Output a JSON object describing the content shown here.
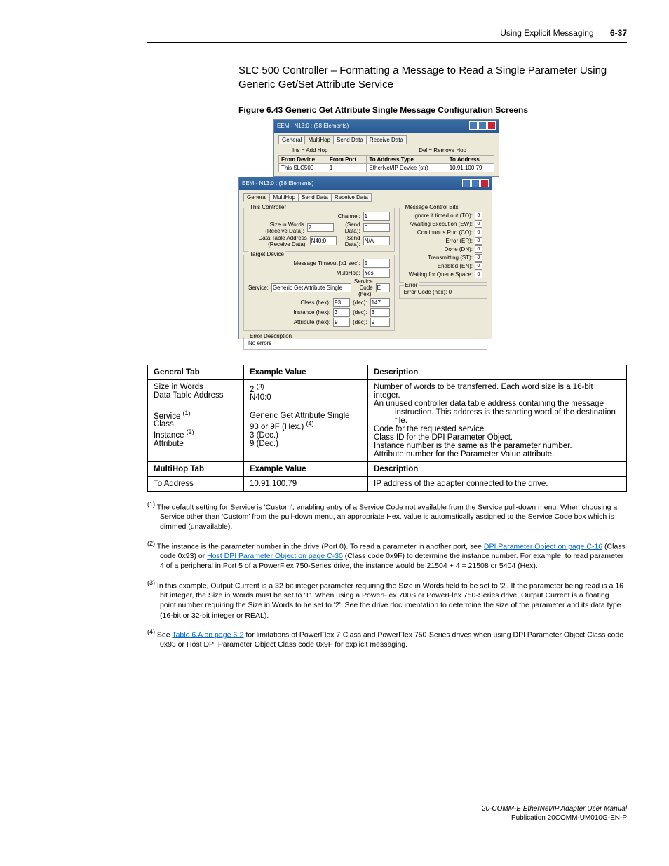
{
  "header": {
    "title": "Using Explicit Messaging",
    "pageno": "6-37"
  },
  "section_title": "SLC 500 Controller – Formatting a Message to Read a Single Parameter Using Generic Get/Set Attribute Service",
  "figure_caption": "Figure 6.43   Generic Get Attribute Single Message Configuration Screens",
  "win_top": {
    "title": "EEM - N13:0 : (58 Elements)",
    "tabs": [
      "General",
      "MultiHop",
      "Send Data",
      "Receive Data"
    ],
    "active_tab": 1,
    "hint_ins": "Ins = Add Hop",
    "hint_del": "Del = Remove Hop",
    "cols": [
      "From Device",
      "From Port",
      "To Address Type",
      "To Address"
    ],
    "row": [
      "This SLC500",
      "1",
      "EtherNet/IP Device (str)",
      "10.91.100.79"
    ]
  },
  "win_main": {
    "title": "EEM - N13:0 : (58 Elements)",
    "tabs": [
      "General",
      "MultiHop",
      "Send Data",
      "Receive Data"
    ],
    "active_tab": 0,
    "this_controller": {
      "legend": "This Controller",
      "channel_lbl": "Channel:",
      "channel": "1",
      "size_lbl": "Size in Words (Receive Data):",
      "size": "2",
      "senddata_lbl": "(Send Data):",
      "senddata": "0",
      "dta_lbl": "Data Table Address (Receive Data):",
      "dta": "N40:0",
      "senddata2_lbl": "(Send Data):",
      "senddata2": "N/A"
    },
    "target_device": {
      "legend": "Target Device",
      "timeout_lbl": "Message Timeout [x1 sec]:",
      "timeout": "5",
      "multihop_lbl": "MultiHop:",
      "multihop": "Yes",
      "service_lbl": "Service:",
      "service": "Generic Get Attribute Single",
      "svccode_lbl": "Service Code (hex):",
      "svccode": "E",
      "class_lbl": "Class (hex):",
      "class_hex": "93",
      "class_dec_lbl": "(dec):",
      "class_dec": "147",
      "inst_lbl": "Instance (hex):",
      "inst_hex": "3",
      "inst_dec_lbl": "(dec):",
      "inst_dec": "3",
      "attr_lbl": "Attribute (hex):",
      "attr_hex": "9",
      "attr_dec_lbl": "(dec):",
      "attr_dec": "9"
    },
    "mcb": {
      "legend": "Message Control Bits",
      "bits": [
        {
          "lbl": "Ignore if timed out (TO):",
          "v": "0"
        },
        {
          "lbl": "Awaiting Execution (EW):",
          "v": "0"
        },
        {
          "lbl": "Continuous Run (CO):",
          "v": "0"
        },
        {
          "lbl": "Error (ER):",
          "v": "0"
        },
        {
          "lbl": "Done (DN):",
          "v": "0"
        },
        {
          "lbl": "Transmitting (ST):",
          "v": "0"
        },
        {
          "lbl": "Enabled (EN):",
          "v": "0"
        },
        {
          "lbl": "Waiting for Queue Space:",
          "v": "0"
        }
      ]
    },
    "error_grp": {
      "legend": "Error",
      "code_lbl": "Error Code (hex): 0"
    },
    "errdesc_grp": {
      "legend": "Error Description",
      "text": "No errors"
    }
  },
  "table": {
    "headers1": [
      "General Tab",
      "Example Value",
      "Description"
    ],
    "rows1": [
      {
        "c1": "Size in Words",
        "c2": "2 ",
        "c2_sup": "(3)",
        "c3": "Number of words to be transferred. Each word size is a 16-bit integer."
      },
      {
        "c1": "Data Table Address",
        "c2": "N40:0",
        "c3": "An unused controller data table address containing the message instruction. This address is the starting word of the destination file.",
        "indent": true
      },
      {
        "c1": "Service ",
        "c1_sup": "(1)",
        "c2": "Generic Get Attribute Single",
        "c3": "Code for the requested service."
      },
      {
        "c1": "Class",
        "c2": "93 or 9F (Hex.) ",
        "c2_sup": "(4)",
        "c3": "Class ID for the DPI Parameter Object."
      },
      {
        "c1": "Instance ",
        "c1_sup": "(2)",
        "c2": "3 (Dec.)",
        "c3": "Instance number is the same as the parameter number."
      },
      {
        "c1": "Attribute",
        "c2": "9 (Dec.)",
        "c3": "Attribute number for the Parameter Value attribute."
      }
    ],
    "headers2": [
      "MultiHop Tab",
      "Example Value",
      "Description"
    ],
    "rows2": [
      {
        "c1": "To Address",
        "c2": "10.91.100.79",
        "c3": "IP address of the adapter connected to the drive."
      }
    ]
  },
  "footnotes": {
    "f1": "The default setting for Service is 'Custom', enabling entry of a Service Code not available from the Service pull-down menu. When choosing a Service other than 'Custom' from the pull-down menu, an appropriate Hex. value is automatically assigned to the Service Code box which is dimmed (unavailable).",
    "f2_a": "The instance is the parameter number in the drive (Port 0). To read a parameter in another port, see ",
    "f2_link1": "DPI Parameter Object on page C-16",
    "f2_b": " (Class code 0x93) or ",
    "f2_link2": "Host DPI Parameter Object on page C-30",
    "f2_c": " (Class code 0x9F) to determine the instance number. For example, to read parameter 4 of a peripheral in Port 5 of a PowerFlex 750-Series drive, the instance would be 21504 + 4 = 21508 or 5404 (Hex).",
    "f3": "In this example, Output Current is a 32-bit integer parameter requiring the Size in Words field to be set to '2'. If the parameter being read is a 16-bit integer, the Size in Words must be set to '1'. When using a PowerFlex 700S or PowerFlex 750-Series drive, Output Current is a floating point number requiring the Size in Words to be set to '2'. See the drive documentation to determine the size of the parameter and its data type (16-bit or 32-bit integer or REAL).",
    "f4_a": "See ",
    "f4_link": "Table 6.A on page 6-2",
    "f4_b": " for limitations of PowerFlex 7-Class and PowerFlex 750-Series drives when using DPI Parameter Object Class code 0x93 or Host DPI Parameter Object Class code 0x9F for explicit messaging."
  },
  "footer": {
    "l1": "20-COMM-E EtherNet/IP Adapter User Manual",
    "l2": "Publication 20COMM-UM010G-EN-P"
  }
}
